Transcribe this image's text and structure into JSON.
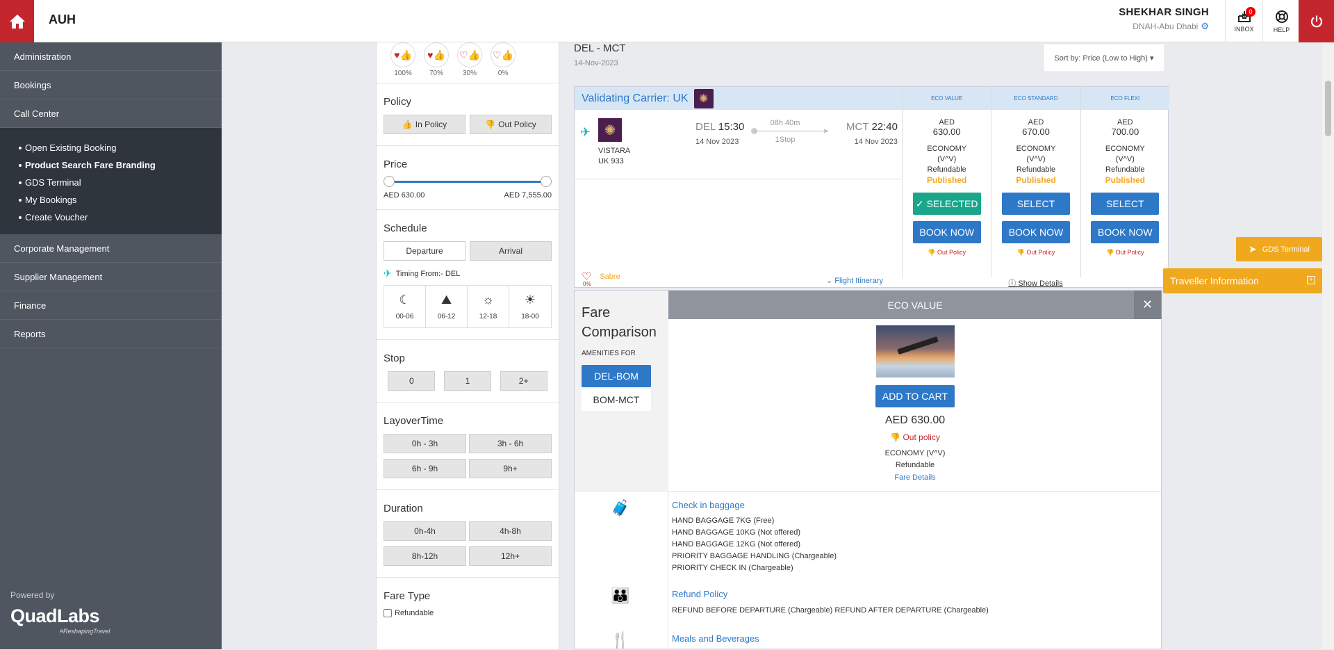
{
  "header": {
    "brand": "AUH",
    "user_name": "SHEKHAR SINGH",
    "user_org": "DNAH-Abu Dhabi",
    "inbox_label": "INBOX",
    "inbox_count": "0",
    "help_label": "HELP"
  },
  "sidebar": {
    "items_top": [
      "Administration",
      "Bookings",
      "Call Center"
    ],
    "submenu": [
      "Open Existing Booking",
      "Product Search Fare Branding",
      "GDS Terminal",
      "My Bookings",
      "Create Voucher"
    ],
    "items_bottom": [
      "Corporate Management",
      "Supplier Management",
      "Finance",
      "Reports"
    ],
    "powered_by": "Powered by",
    "logo_text": "QuadLabs",
    "logo_tag": "#ReshapingTravel"
  },
  "filters": {
    "ratings": [
      "100%",
      "70%",
      "30%",
      "0%"
    ],
    "policy_title": "Policy",
    "in_policy": "In Policy",
    "out_policy": "Out Policy",
    "price_title": "Price",
    "price_min": "AED 630.00",
    "price_max": "AED 7,555.00",
    "schedule_title": "Schedule",
    "departure": "Departure",
    "arrival": "Arrival",
    "timing_from": "Timing From:- DEL",
    "slots": [
      "00-06",
      "06-12",
      "12-18",
      "18-00"
    ],
    "stop_title": "Stop",
    "stops": [
      "0",
      "1",
      "2+"
    ],
    "layover_title": "LayoverTime",
    "layovers": [
      "0h - 3h",
      "3h - 6h",
      "6h - 9h",
      "9h+"
    ],
    "duration_title": "Duration",
    "durations": [
      "0h-4h",
      "4h-8h",
      "8h-12h",
      "12h+"
    ],
    "faretype_title": "Fare Type",
    "refundable": "Refundable"
  },
  "main": {
    "route": "DEL - MCT",
    "date": "14-Nov-2023",
    "sort": "Sort by: Price (Low to High) ▾",
    "validating": "Validating Carrier: UK",
    "airline": "VISTARA",
    "flight_no": "UK  933",
    "dep_code": "DEL",
    "dep_time": "15:30",
    "dep_date": "14 Nov 2023",
    "duration": "08h 40m",
    "stops": "1Stop",
    "arr_code": "MCT",
    "arr_time": "22:40",
    "arr_date": "14 Nov 2023",
    "sabre": "Sabre",
    "heart_pct": "0%",
    "itinerary": "Flight Itinerary",
    "show_details": "Show Details",
    "fares": [
      {
        "head": "ECO VALUE",
        "cur": "AED",
        "amt": "630.00",
        "cls": "ECONOMY",
        "code": "(V^V)",
        "ref": "Refundable",
        "pub": "Published",
        "btn": "SELECTED",
        "book": "BOOK NOW",
        "pol": "Out Policy"
      },
      {
        "head": "ECO STANDARD",
        "cur": "AED",
        "amt": "670.00",
        "cls": "ECONOMY",
        "code": "(V^V)",
        "ref": "Refundable",
        "pub": "Published",
        "btn": "SELECT",
        "book": "BOOK NOW",
        "pol": "Out Policy"
      },
      {
        "head": "ECO FLEXI",
        "cur": "AED",
        "amt": "700.00",
        "cls": "ECONOMY",
        "code": "(V^V)",
        "ref": "Refundable",
        "pub": "Published",
        "btn": "SELECT",
        "book": "BOOK NOW",
        "pol": "Out Policy"
      }
    ]
  },
  "compare": {
    "title_1": "Fare",
    "title_2": "Comparison",
    "amenities_for": "AMENITIES FOR",
    "seg1": "DEL-BOM",
    "seg2": "BOM-MCT",
    "head": "ECO VALUE",
    "add_to_cart": "ADD TO CART",
    "price": "AED 630.00",
    "policy": "Out policy",
    "cls": "ECONOMY (V^V)",
    "ref": "Refundable",
    "fare_details": "Fare Details",
    "baggage_title": "Check in baggage",
    "baggage": [
      "HAND BAGGAGE 7KG (Free)",
      "HAND BAGGAGE 10KG (Not offered)",
      "HAND BAGGAGE 12KG (Not offered)",
      "PRIORITY BAGGAGE HANDLING (Chargeable)",
      "PRIORITY CHECK IN (Chargeable)"
    ],
    "refund_title": "Refund Policy",
    "refund": "REFUND BEFORE DEPARTURE (Chargeable) REFUND AFTER DEPARTURE (Chargeable)",
    "meals_title": "Meals and Beverages"
  },
  "floating": {
    "gds": "GDS Terminal",
    "traveller": "Traveller Information"
  }
}
